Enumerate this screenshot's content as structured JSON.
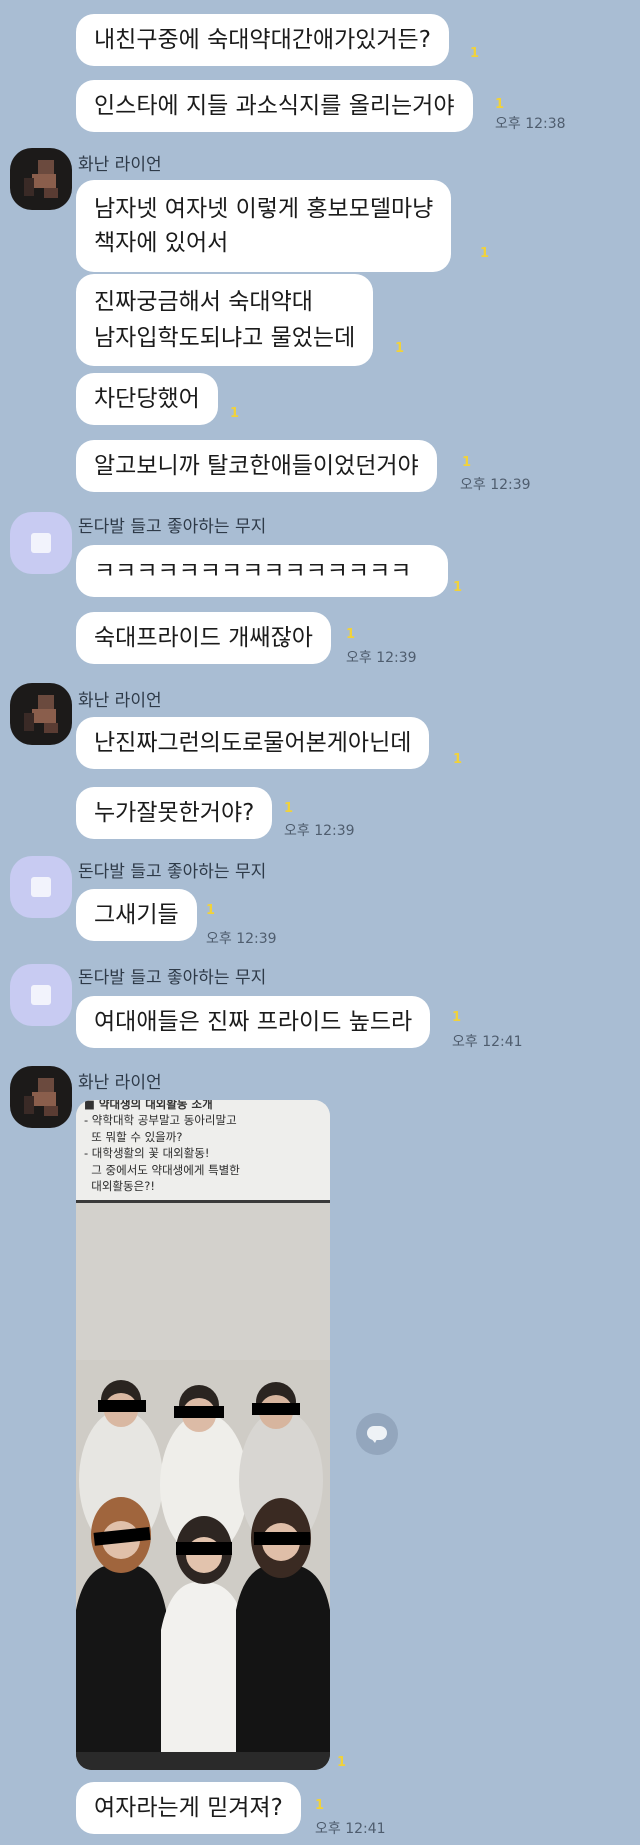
{
  "senders": {
    "hwanan": "화난 라이언",
    "muzi": "돈다발 들고 좋아하는 무지"
  },
  "icons": {
    "unread": "unread-count",
    "share": "share-icon"
  },
  "colors": {
    "background": "#a9bdd3",
    "bubble": "#ffffff",
    "unread": "#f1d23a"
  },
  "messages": {
    "m1": {
      "text": "내친구중에 숙대약대간애가있거든?",
      "unread": "1"
    },
    "m2": {
      "text": "인스타에 지들 과소식지를 올리는거야",
      "unread": "1",
      "time": "오후 12:38"
    },
    "m3": {
      "text": "남자넷 여자넷 이렇게 홍보모델마냥\n책자에 있어서",
      "unread": "1"
    },
    "m4": {
      "text": "진짜궁금해서 숙대약대\n남자입학도되냐고 물었는데",
      "unread": "1"
    },
    "m5": {
      "text": "차단당했어",
      "unread": "1"
    },
    "m6": {
      "text": "알고보니까 탈코한애들이었던거야",
      "unread": "1",
      "time": "오후 12:39"
    },
    "m7": {
      "text": "ㅋㅋㅋㅋㅋㅋㅋㅋㅋㅋㅋㅋㅋㅋㅋ",
      "unread": "1"
    },
    "m8": {
      "text": "숙대프라이드 개쌔잖아",
      "unread": "1",
      "time": "오후 12:39"
    },
    "m9": {
      "text": "난진짜그런의도로물어본게아닌데",
      "unread": "1"
    },
    "m10": {
      "text": "누가잘못한거야?",
      "unread": "1",
      "time": "오후 12:39"
    },
    "m11": {
      "text": "그새기들",
      "unread": "1",
      "time": "오후 12:39"
    },
    "m12": {
      "text": "여대애들은 진짜 프라이드 높드라",
      "unread": "1",
      "time": "오후 12:41"
    },
    "m13": {
      "unread": "1"
    },
    "m14": {
      "text": "여자라는게 믿겨져?",
      "unread": "1",
      "time": "오후 12:41"
    }
  },
  "photo": {
    "heading": "■ 약대생의 대외활동 소개",
    "caption": "- 약학대학 공부말고 동아리말고\n  또 뭐할 수 있을까?\n- 대학생활의 꽃 대외활동!\n  그 중에서도 약대생에게 특별한\n  대외활동은?!"
  }
}
